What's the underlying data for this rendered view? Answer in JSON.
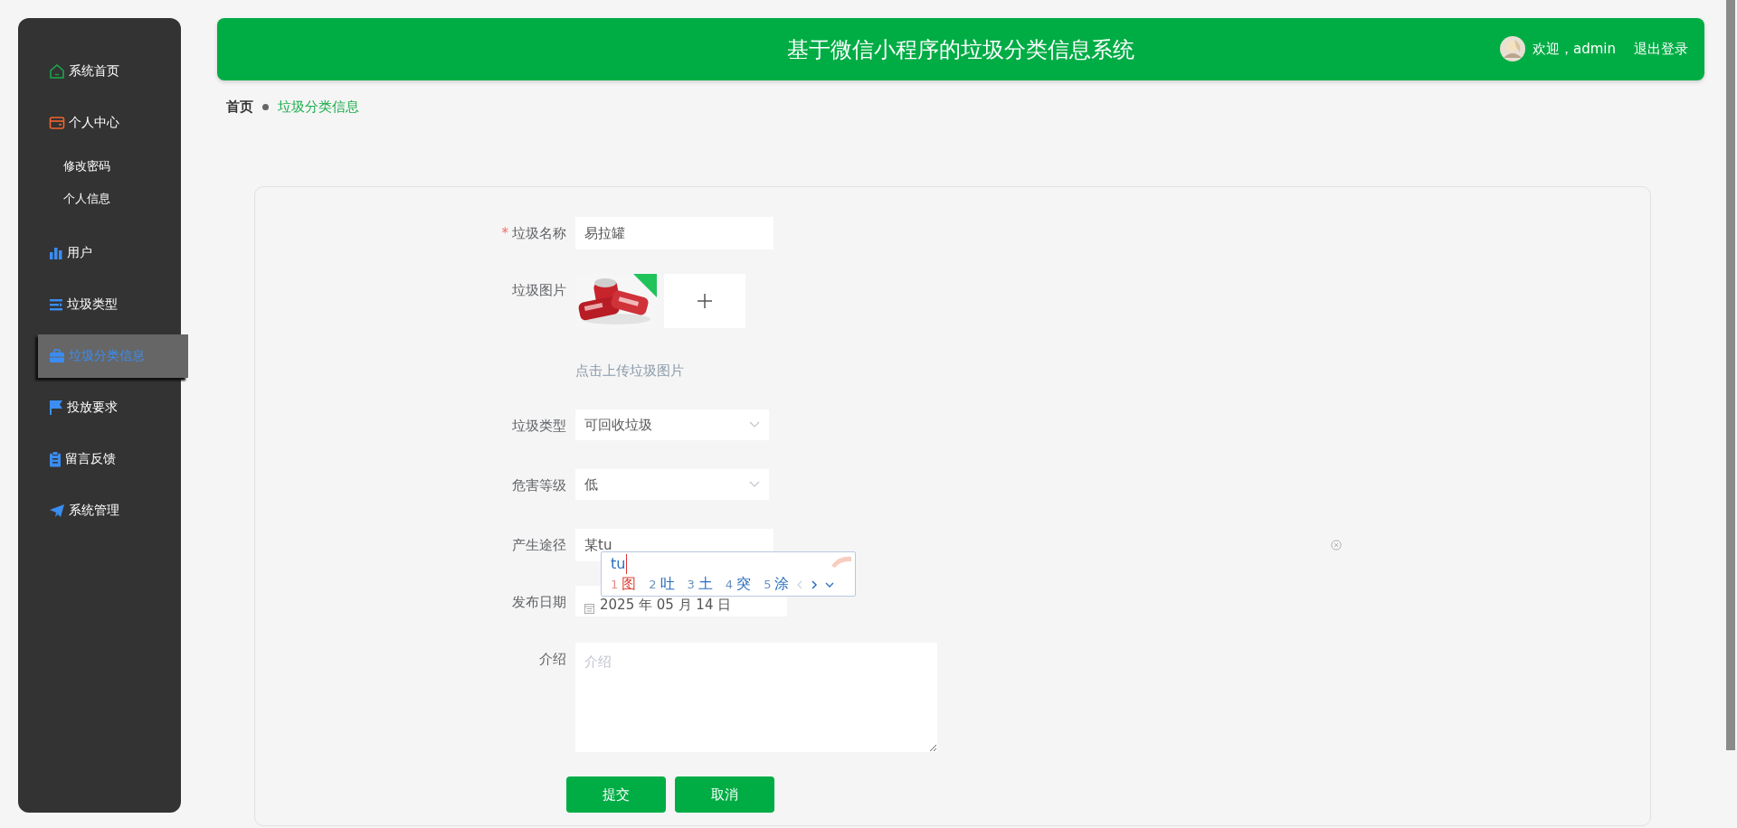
{
  "header": {
    "title": "基于微信小程序的垃圾分类信息系统",
    "welcome": "欢迎，admin",
    "logout": "退出登录"
  },
  "sidebar": {
    "items": [
      {
        "label": "系统首页",
        "selected": false
      },
      {
        "label": "个人中心",
        "selected": false,
        "children": [
          {
            "label": "修改密码",
            "selected": false
          },
          {
            "label": "个人信息",
            "selected": false
          }
        ]
      },
      {
        "label": "用户",
        "selected": false
      },
      {
        "label": "垃圾类型",
        "selected": false
      },
      {
        "label": "垃圾分类信息",
        "selected": true
      },
      {
        "label": "投放要求",
        "selected": false
      },
      {
        "label": "留言反馈",
        "selected": false
      },
      {
        "label": "系统管理",
        "selected": false
      }
    ]
  },
  "breadcrumb": [
    {
      "label": "首页",
      "selected": false
    },
    {
      "label": "垃圾分类信息",
      "selected": true
    }
  ],
  "form": {
    "fields": [
      {
        "kind": "text",
        "label": "垃圾名称",
        "required_mark": "*",
        "value": "易拉罐"
      },
      {
        "label": "垃圾图片",
        "hint": "点击上传垃圾图片"
      },
      {
        "kind": "select",
        "label": "垃圾类型",
        "value": "可回收垃圾"
      },
      {
        "kind": "select",
        "label": "危害等级",
        "value": "低"
      },
      {
        "kind": "text",
        "label": "产生途径",
        "value": "某tu",
        "clearable": true
      },
      {
        "kind": "date",
        "label": "发布日期",
        "value": "2025 年 05 月 14 日"
      },
      {
        "kind": "textarea",
        "label": "介绍",
        "placeholder": "介绍"
      }
    ],
    "buttons": [
      "提交",
      "取消"
    ]
  },
  "ime": {
    "composition": "tu",
    "candidates": [
      {
        "index": "1",
        "text": "图",
        "selected": true
      },
      {
        "index": "2",
        "text": "吐",
        "selected": false
      },
      {
        "index": "3",
        "text": "土",
        "selected": false
      },
      {
        "index": "4",
        "text": "突",
        "selected": false
      },
      {
        "index": "5",
        "text": "涂",
        "selected": false
      }
    ]
  }
}
